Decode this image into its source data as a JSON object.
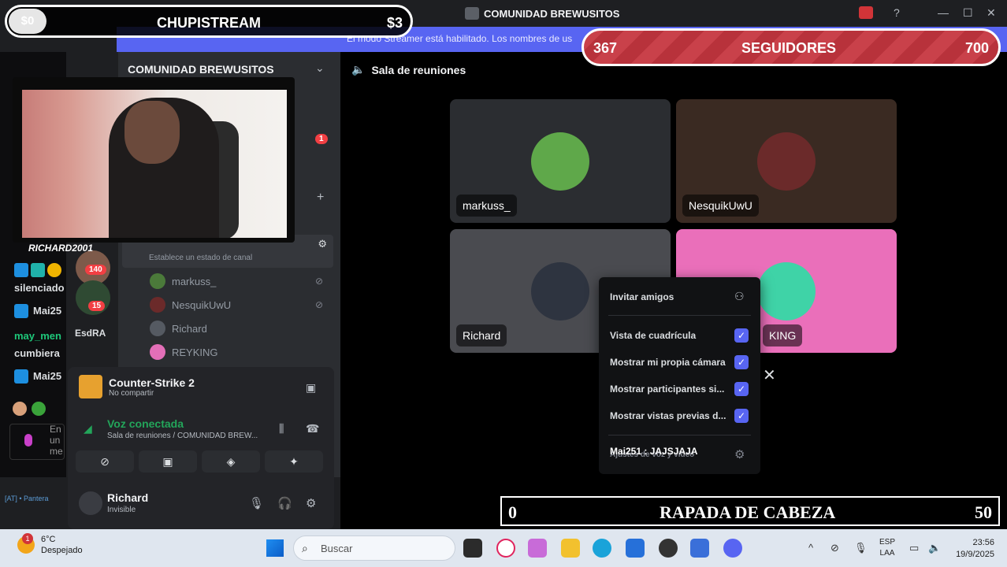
{
  "window": {
    "title": "COMUNIDAD BREWUSITOS"
  },
  "banner": {
    "text": "El modo Streamer está habilitado. Los nombres de us"
  },
  "overlay_top": {
    "left_value": "$0",
    "title": "CHUPISTREAM",
    "right_value": "$3"
  },
  "overlay_followers": {
    "current": "367",
    "label": "SEGUIDORES",
    "goal": "700"
  },
  "overlay_bottom": {
    "left_value": "0",
    "title": "RAPADA DE CABEZA",
    "right_value": "50"
  },
  "webcam": {
    "name": "RICHARD2001"
  },
  "chat": {
    "lines": [
      {
        "text": "silenciado",
        "color": "#ffffff"
      },
      {
        "text": "Mai25",
        "color": "#ffffff"
      },
      {
        "text": "may_men",
        "color": "#1ec77a"
      },
      {
        "text": "cumbiera",
        "color": "#ffffff"
      },
      {
        "text": "Mai25",
        "color": "#ffffff"
      }
    ],
    "input_lines": [
      "En",
      "un",
      "me"
    ],
    "footer": "[AT] • Pantera"
  },
  "server": {
    "name": "COMUNIDAD BREWUSITOS",
    "badges": {
      "top": "1",
      "a": "140",
      "b": "15"
    },
    "side_label": "EsdRA"
  },
  "voice_channel": {
    "name": "Sala de reuniones",
    "status_placeholder": "Establece un estado de canal",
    "members": [
      "markuss_",
      "NesquikUwU",
      "Richard",
      "REYKING"
    ]
  },
  "user_panel": {
    "game_title": "Counter-Strike 2",
    "game_sub": "No compartir",
    "voice_status": "Voz conectada",
    "voice_sub": "Sala de reuniones / COMUNIDAD BREW...",
    "username": "Richard",
    "user_status": "Invisible"
  },
  "stage": {
    "title": "Sala de reuniones",
    "tiles": [
      {
        "name": "markuss_",
        "bg": "#2b2d31"
      },
      {
        "name": "NesquikUwU",
        "bg": "#3a2a22"
      },
      {
        "name": "Richard",
        "bg": "#4a4b50"
      },
      {
        "name": "KING",
        "bg": "#ea6fba"
      }
    ]
  },
  "menu": {
    "invite": "Invitar amigos",
    "options": [
      "Vista de cuadrícula",
      "Mostrar mi propia cámara",
      "Mostrar participantes si...",
      "Mostrar vistas previas d..."
    ],
    "chat_overlay": "Mai251 : JAJSJAJA",
    "footer_hidden": "Ajustes de voz y vídeo"
  },
  "taskbar": {
    "temp": "6°C",
    "weather": "Despejado",
    "weather_badge": "1",
    "search_placeholder": "Buscar",
    "lang_top": "ESP",
    "lang_bottom": "LAA",
    "time": "23:56",
    "date": "19/9/2025"
  },
  "colors": {
    "accent": "#5865f2",
    "voice_green": "#23a55a",
    "alert": "#f23f43"
  }
}
